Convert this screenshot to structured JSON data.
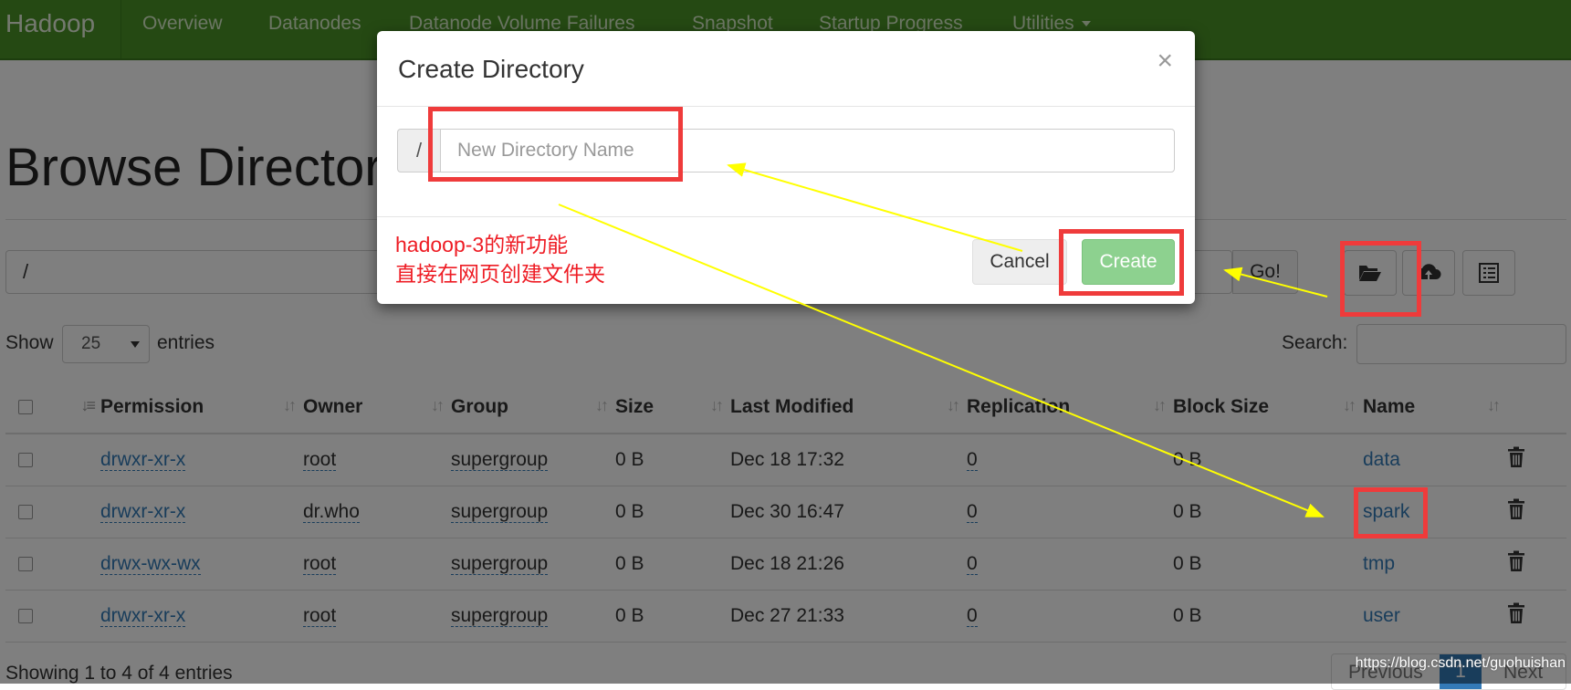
{
  "navbar": {
    "brand": "Hadoop",
    "items": [
      "Overview",
      "Datanodes",
      "Datanode Volume Failures",
      "Snapshot",
      "Startup Progress",
      "Utilities"
    ]
  },
  "page": {
    "title": "Browse Directory",
    "path": "/",
    "go_label": "Go!",
    "show_label": "Show",
    "entries_value": "25",
    "entries_label": "entries",
    "search_label": "Search:",
    "footer_info": "Showing 1 to 4 of 4 entries",
    "pager": {
      "previous": "Previous",
      "current": "1",
      "next": "Next"
    }
  },
  "toolbar": {
    "icons": [
      "folder-open-icon",
      "cloud-upload-icon",
      "list-icon"
    ]
  },
  "table": {
    "columns": [
      "Permission",
      "Owner",
      "Group",
      "Size",
      "Last Modified",
      "Replication",
      "Block Size",
      "Name"
    ],
    "rows": [
      {
        "permission": "drwxr-xr-x",
        "owner": "root",
        "group": "supergroup",
        "size": "0 B",
        "modified": "Dec 18 17:32",
        "replication": "0",
        "block_size": "0 B",
        "name": "data"
      },
      {
        "permission": "drwxr-xr-x",
        "owner": "dr.who",
        "group": "supergroup",
        "size": "0 B",
        "modified": "Dec 30 16:47",
        "replication": "0",
        "block_size": "0 B",
        "name": "spark"
      },
      {
        "permission": "drwx-wx-wx",
        "owner": "root",
        "group": "supergroup",
        "size": "0 B",
        "modified": "Dec 18 21:26",
        "replication": "0",
        "block_size": "0 B",
        "name": "tmp"
      },
      {
        "permission": "drwxr-xr-x",
        "owner": "root",
        "group": "supergroup",
        "size": "0 B",
        "modified": "Dec 27 21:33",
        "replication": "0",
        "block_size": "0 B",
        "name": "user"
      }
    ]
  },
  "modal": {
    "title": "Create Directory",
    "close": "×",
    "prefix": "/",
    "input_placeholder": "New Directory Name",
    "note_line1": "hadoop-3的新功能",
    "note_line2": "直接在网页创建文件夹",
    "cancel_label": "Cancel",
    "create_label": "Create"
  },
  "watermark": "https://blog.csdn.net/guohuishan",
  "colors": {
    "navbar": "#4b9327",
    "link": "#337ab7",
    "create_button": "#8dd18f",
    "note_text": "#ee1c24",
    "highlight_box": "#ef3b3b",
    "arrow": "#ffff00"
  }
}
